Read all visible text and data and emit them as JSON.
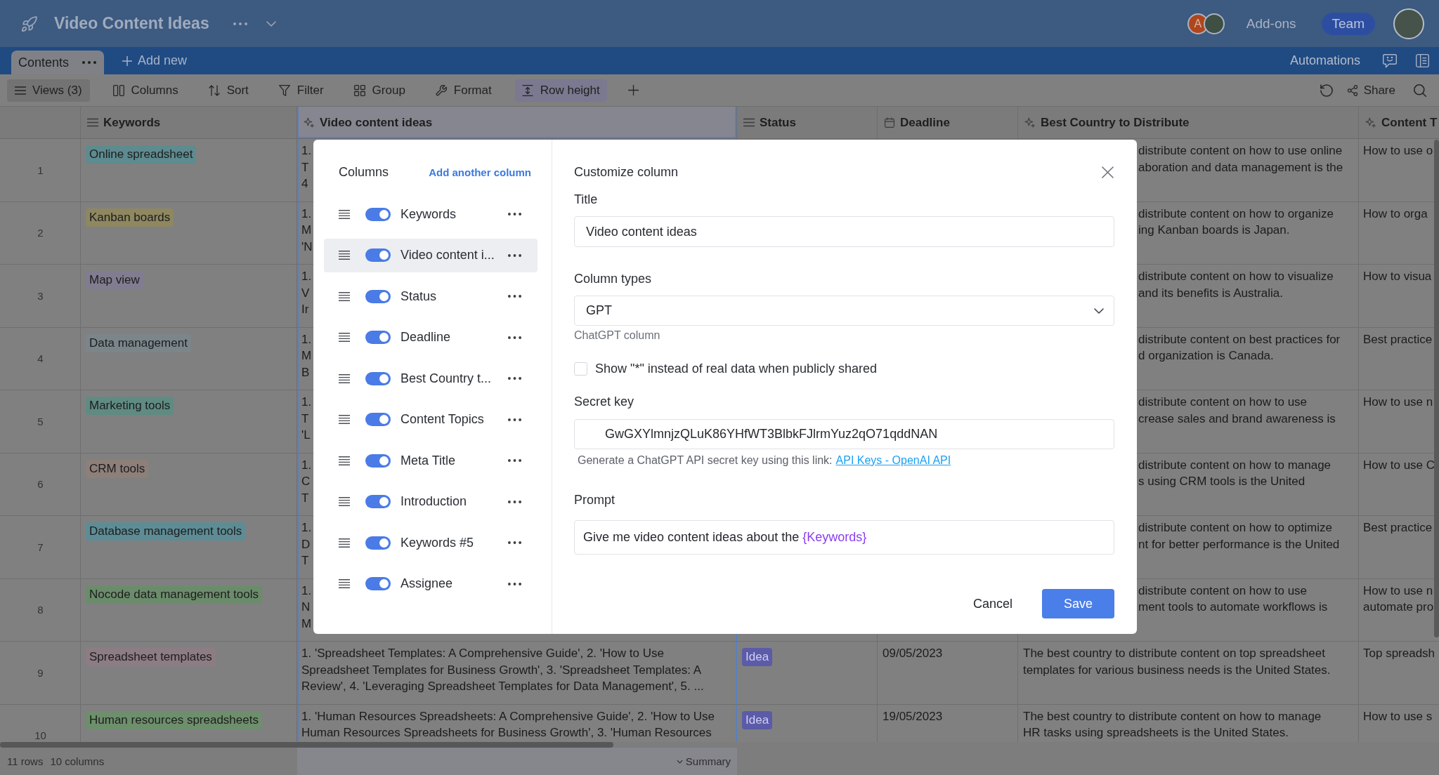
{
  "app_bar": {
    "title": "Video Content Ideas",
    "collaborators": [
      {
        "kind": "letter",
        "initial": "A"
      },
      {
        "kind": "photo"
      }
    ],
    "addons": "Add-ons",
    "team": "Team"
  },
  "tabs": [
    {
      "label": "Contents",
      "selected": true
    }
  ],
  "tab_bar": {
    "add_new": "Add new",
    "automations": "Automations"
  },
  "toolbar": {
    "views": "Views (3)",
    "tools": [
      {
        "kind": "columns",
        "label": "Columns",
        "selected": false
      },
      {
        "kind": "sort",
        "label": "Sort",
        "selected": false
      },
      {
        "kind": "filter",
        "label": "Filter",
        "selected": false
      },
      {
        "kind": "group",
        "label": "Group",
        "selected": false
      },
      {
        "kind": "format",
        "label": "Format",
        "selected": false
      },
      {
        "kind": "rowheight",
        "label": "Row height",
        "selected": true
      }
    ],
    "share": "Share"
  },
  "table": {
    "columns": [
      {
        "label": "Keywords",
        "kind": "text",
        "selected": false
      },
      {
        "label": "Video content ideas",
        "kind": "ai",
        "selected": true
      },
      {
        "label": "Status",
        "kind": "text",
        "selected": false
      },
      {
        "label": "Deadline",
        "kind": "date",
        "selected": false
      },
      {
        "label": "Best Country to Distribute",
        "kind": "ai",
        "selected": false
      },
      {
        "label": "Content T",
        "kind": "ai",
        "selected": false
      }
    ],
    "rows": [
      {
        "number": "1",
        "keyword": {
          "label": "Online spreadsheet",
          "color": "#5d8b8f"
        },
        "video_content_ideas": [
          "1.",
          "T",
          "4"
        ],
        "best_country": [
          "distribute content on how to use online",
          "aboration and data management is the"
        ],
        "content_topics": [
          "How to use o"
        ]
      },
      {
        "number": "2",
        "keyword": {
          "label": "Kanban boards",
          "color": "#8e8760"
        },
        "video_content_ideas": [
          "1.",
          "M",
          "'N"
        ],
        "best_country": [
          "distribute content on how to organize",
          "ing Kanban boards is Japan."
        ],
        "content_topics": [
          "How to orga"
        ]
      },
      {
        "number": "3",
        "keyword": {
          "label": "Map view",
          "color": "#817c8f"
        },
        "video_content_ideas": [
          "1.",
          "V",
          "Ir"
        ],
        "best_country": [
          "distribute content on how to visualize",
          "and its benefits is Australia."
        ],
        "content_topics": [
          "How to visua"
        ]
      },
      {
        "number": "4",
        "keyword": {
          "label": "Data management",
          "color": "#7b868b"
        },
        "video_content_ideas": [
          "1.",
          "M",
          "B"
        ],
        "best_country": [
          "distribute content on best practices for",
          "d organization is Canada."
        ],
        "content_topics": [
          "Best practice"
        ]
      },
      {
        "number": "5",
        "keyword": {
          "label": "Marketing tools",
          "color": "#5f8b82"
        },
        "video_content_ideas": [
          "1.",
          "T",
          "'L"
        ],
        "best_country": [
          "distribute content on how to use",
          "crease sales and brand awareness is"
        ],
        "content_topics": [
          "How to use n"
        ]
      },
      {
        "number": "6",
        "keyword": {
          "label": "CRM tools",
          "color": "#8d7f79"
        },
        "video_content_ideas": [
          "1.",
          "C",
          "T"
        ],
        "best_country": [
          "distribute content on how to manage",
          "s using CRM tools is the United"
        ],
        "content_topics": [
          "How to use C"
        ]
      },
      {
        "number": "7",
        "keyword": {
          "label": "Database management tools",
          "color": "#5e8c95"
        },
        "video_content_ideas": [
          "1.",
          "D",
          "T"
        ],
        "best_country": [
          "distribute content on how to optimize",
          "nt for better performance is the United"
        ],
        "content_topics": [
          "Best practice"
        ]
      },
      {
        "number": "8",
        "keyword": {
          "label": "Nocode data management tools",
          "color": "#6b8c6b"
        },
        "video_content_ideas": [
          "1.",
          "N",
          "M"
        ],
        "best_country": [
          "distribute content on how to use",
          "ment tools to automate workflows is"
        ],
        "content_topics": [
          "How to use n",
          "automate pro"
        ]
      },
      {
        "number": "9",
        "keyword": {
          "label": "Spreadsheet templates",
          "color": "#8d7c83"
        },
        "video_content_ideas": [
          "1. 'Spreadsheet Templates: A Comprehensive Guide', 2. 'How to Use",
          "Spreadsheet Templates for Business Growth', 3. 'Spreadsheet Templates: A",
          "Review', 4. 'Leveraging Spreadsheet Templates for Data Management', 5. ..."
        ],
        "status": {
          "label": "Idea",
          "color": "#5b5ba8"
        },
        "deadline": "09/05/2023",
        "best_country": [
          "The best country to distribute content on top spreadsheet",
          "templates for various business needs is the United States."
        ],
        "content_topics": [
          "Top spreadsh"
        ]
      },
      {
        "number": "10",
        "keyword": {
          "label": "Human resources spreadsheets",
          "color": "#6d8f6c"
        },
        "video_content_ideas": [
          "1. 'Human Resources Spreadsheets: A Comprehensive Guide', 2. 'How to Use",
          "Human Resources Spreadsheets for Business Growth', 3. 'Human Resources"
        ],
        "status": {
          "label": "Idea",
          "color": "#5b5ba8"
        },
        "deadline": "19/05/2023",
        "best_country": [
          "The best country to distribute content on how to manage",
          "HR tasks using spreadsheets is the United States."
        ],
        "content_topics": [
          "How to use s"
        ]
      }
    ]
  },
  "footer": {
    "rows": "11 rows",
    "columns": "10 columns",
    "summary": "Summary"
  },
  "dialog": {
    "columns_heading": "Columns",
    "add_column": "Add another column",
    "columns": [
      {
        "label": "Keywords",
        "on": true,
        "selected": false
      },
      {
        "label": "Video content i...",
        "on": true,
        "selected": true
      },
      {
        "label": "Status",
        "on": true,
        "selected": false
      },
      {
        "label": "Deadline",
        "on": true,
        "selected": false
      },
      {
        "label": "Best Country t...",
        "on": true,
        "selected": false
      },
      {
        "label": "Content Topics",
        "on": true,
        "selected": false
      },
      {
        "label": "Meta Title",
        "on": true,
        "selected": false
      },
      {
        "label": "Introduction",
        "on": true,
        "selected": false
      },
      {
        "label": "Keywords #5",
        "on": true,
        "selected": false
      },
      {
        "label": "Assignee",
        "on": true,
        "selected": false
      }
    ],
    "title": "Customize column",
    "title_field": {
      "label": "Title",
      "value": "Video content ideas"
    },
    "type_field": {
      "label": "Column types",
      "value": "GPT",
      "hint": "ChatGPT column"
    },
    "mask_option": {
      "label": "Show \"*\" instead of real data when publicly shared",
      "checked": false
    },
    "secret_key": {
      "label": "Secret key",
      "value": "GwGXYlmnjzQLuK86YHfWT3BlbkFJlrmYuz2qO71qddNAN",
      "help": "Generate a ChatGPT API secret key using this link:",
      "link": "API Keys - OpenAI API"
    },
    "prompt": {
      "label": "Prompt",
      "text": "Give me video content ideas about the",
      "variable": "{Keywords}"
    },
    "buttons": [
      {
        "kind": "secondary",
        "label": "Cancel"
      },
      {
        "kind": "primary",
        "label": "Save"
      }
    ]
  }
}
